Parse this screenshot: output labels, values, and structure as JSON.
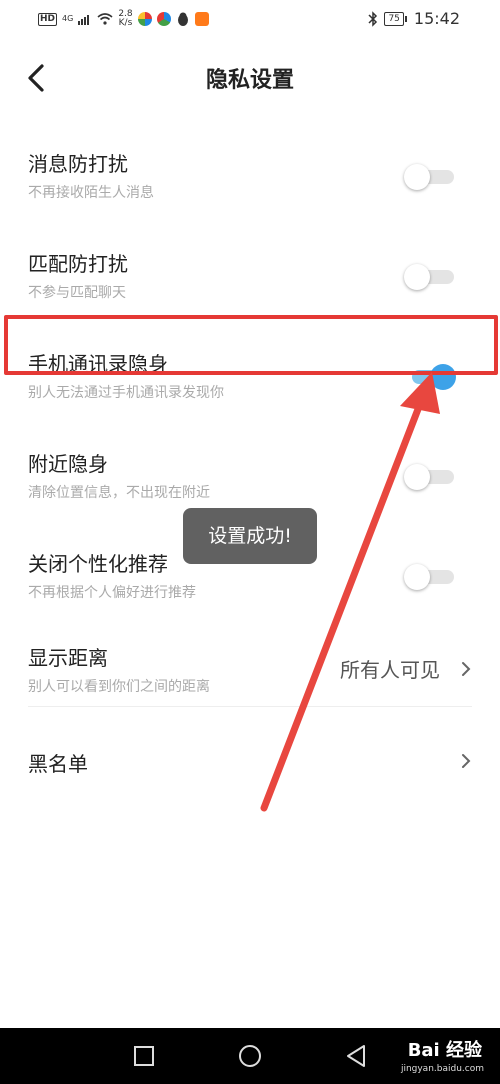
{
  "status_bar": {
    "hd": "HD",
    "net": "4G",
    "speed_value": "2.8",
    "speed_unit": "K/s",
    "battery": "75",
    "time": "15:42"
  },
  "header": {
    "title": "隐私设置"
  },
  "settings": [
    {
      "label": "消息防打扰",
      "sub": "不再接收陌生人消息",
      "on": false
    },
    {
      "label": "匹配防打扰",
      "sub": "不参与匹配聊天",
      "on": false
    },
    {
      "label": "手机通讯录隐身",
      "sub": "别人无法通过手机通讯录发现你",
      "on": true
    },
    {
      "label": "附近隐身",
      "sub": "清除位置信息，不出现在附近",
      "on": false
    },
    {
      "label": "关闭个性化推荐",
      "sub": "不再根据个人偏好进行推荐",
      "on": false
    }
  ],
  "distance": {
    "label": "显示距离",
    "sub": "别人可以看到你们之间的距离",
    "value": "所有人可见"
  },
  "blacklist": {
    "label": "黑名单"
  },
  "toast": {
    "text": "设置成功!"
  },
  "watermark": {
    "brand": "Bai 经验",
    "url": "jingyan.baidu.com"
  },
  "colors": {
    "accent": "#3da2e8",
    "annotation": "#e53935"
  }
}
